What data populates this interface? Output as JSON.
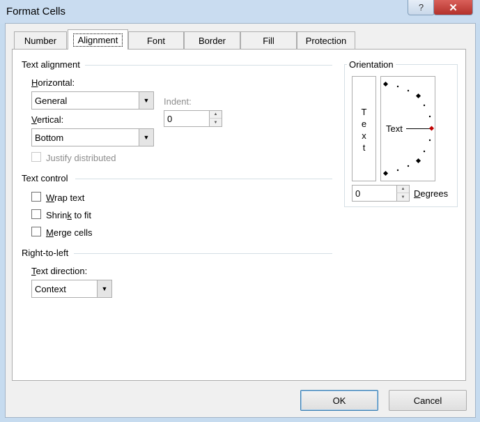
{
  "window": {
    "title": "Format Cells",
    "help_glyph": "?",
    "close_glyph": "✕"
  },
  "tabs": [
    {
      "label": "Number"
    },
    {
      "label": "Alignment"
    },
    {
      "label": "Font"
    },
    {
      "label": "Border"
    },
    {
      "label": "Fill"
    },
    {
      "label": "Protection"
    }
  ],
  "text_alignment": {
    "heading": "Text alignment",
    "horizontal": {
      "label_first": "H",
      "label_rest": "orizontal:",
      "value": "General"
    },
    "vertical": {
      "label_first": "V",
      "label_rest": "ertical:",
      "value": "Bottom"
    },
    "indent": {
      "label": "Indent:",
      "value": "0"
    },
    "justify_distributed": {
      "label": "Justify distributed",
      "checked": false,
      "disabled": true
    }
  },
  "text_control": {
    "heading": "Text control",
    "wrap_text": {
      "label_first": "W",
      "label_rest": "rap text",
      "checked": false
    },
    "shrink_to_fit": {
      "label_pre": "Shrin",
      "label_u": "k",
      "label_post": " to fit",
      "checked": false
    },
    "merge_cells": {
      "label_first": "M",
      "label_rest": "erge cells",
      "checked": false
    }
  },
  "rtl": {
    "heading": "Right-to-left",
    "text_direction": {
      "label_first": "T",
      "label_rest": "ext direction:",
      "value": "Context"
    }
  },
  "orientation": {
    "heading": "Orientation",
    "vertical_text": [
      "T",
      "e",
      "x",
      "t"
    ],
    "dial_label": "Text",
    "degrees_value": "0",
    "degrees_label_first": "D",
    "degrees_label_rest": "egrees",
    "angle_degrees": 0
  },
  "buttons": {
    "ok": "OK",
    "cancel": "Cancel"
  },
  "colors": {
    "accent_dot": "#c00000",
    "title_bar": "#c9dcf0",
    "close": "#c4403a"
  }
}
